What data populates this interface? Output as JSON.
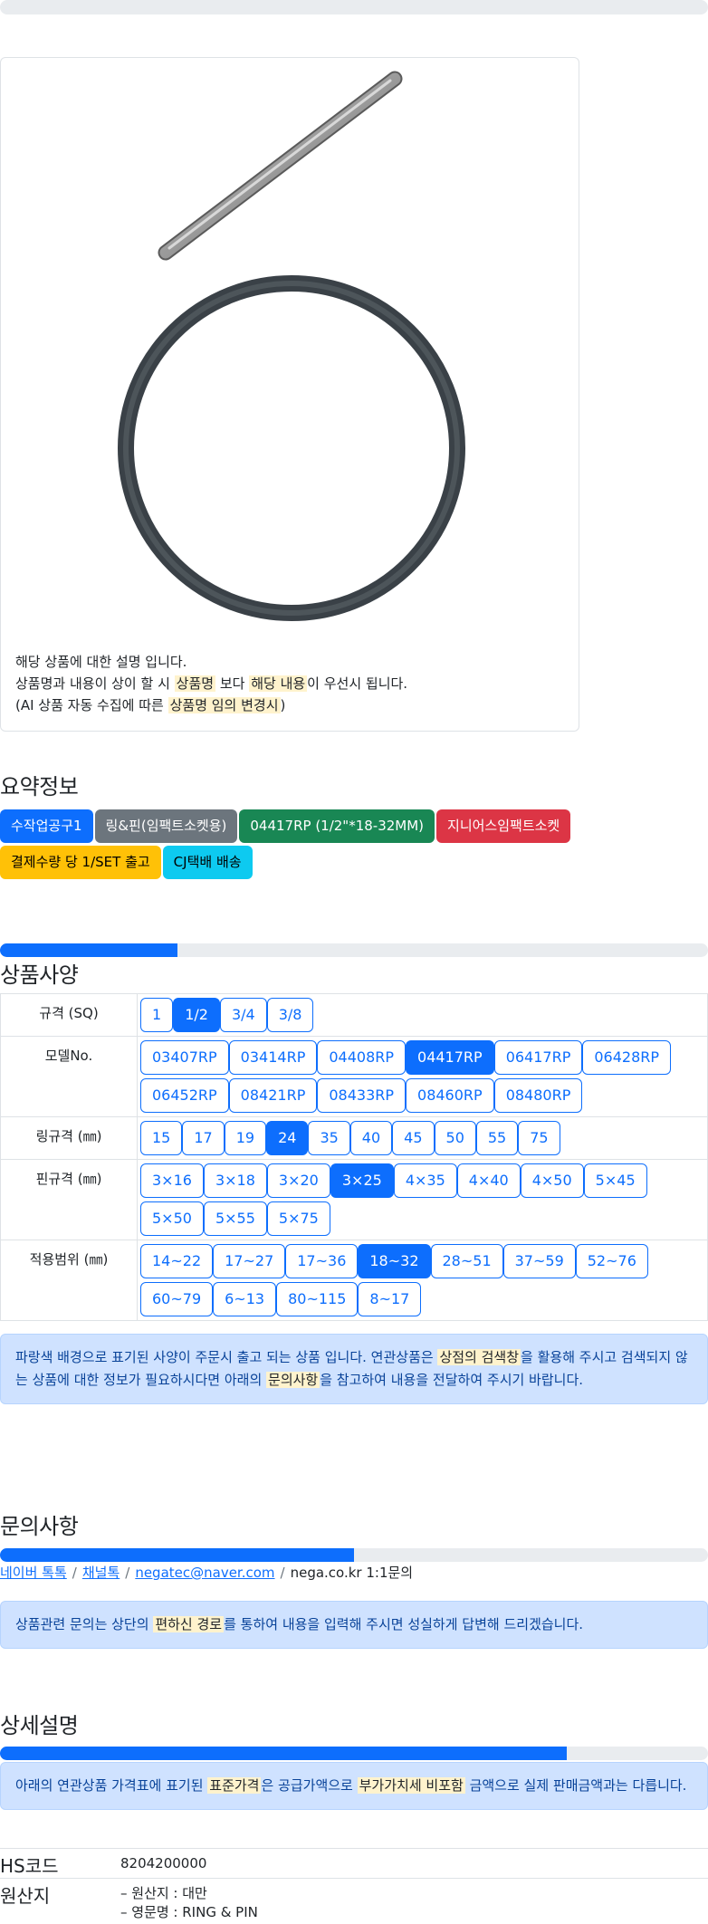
{
  "product_notice": {
    "line1": "해당 상품에 대한 설명 입니다.",
    "line2_a": "상품명과 내용이 상이 할 시 ",
    "line2_hl1": "상품명",
    "line2_b": " 보다 ",
    "line2_hl2": "해당 내용",
    "line2_c": "이 우선시 됩니다.",
    "line3_a": "(AI 상품 자동 수집에 따른 ",
    "line3_hl": "상품명 임의 변경시",
    "line3_b": ")"
  },
  "summary": {
    "title": "요약정보",
    "badges": [
      {
        "label": "수작업공구1",
        "color": "#0d6efd"
      },
      {
        "label": "링&핀(임팩트소켓용)",
        "color": "#6c757d"
      },
      {
        "label": "04417RP (1/2\"*18-32MM)",
        "color": "#198754"
      },
      {
        "label": "지니어스임팩트소켓",
        "color": "#dc3545"
      },
      {
        "label": "결제수량 당 1/SET 출고",
        "color": "#ffc107"
      },
      {
        "label": "CJ택배 배송",
        "color": "#0dcaf0"
      }
    ]
  },
  "spec": {
    "title": "상품사양",
    "progress": 0.25,
    "rows": [
      {
        "label": "규격 (SQ)",
        "options": [
          "1",
          "1/2",
          "3/4",
          "3/8"
        ],
        "selected": "1/2"
      },
      {
        "label": "모델No.",
        "options": [
          "03407RP",
          "03414RP",
          "04408RP",
          "04417RP",
          "06417RP",
          "06428RP",
          "06452RP",
          "08421RP",
          "08433RP",
          "08460RP",
          "08480RP"
        ],
        "selected": "04417RP"
      },
      {
        "label": "링규격 (㎜)",
        "options": [
          "15",
          "17",
          "19",
          "24",
          "35",
          "40",
          "45",
          "50",
          "55",
          "75"
        ],
        "selected": "24"
      },
      {
        "label": "핀규격 (㎜)",
        "options": [
          "3×16",
          "3×18",
          "3×20",
          "3×25",
          "4×35",
          "4×40",
          "4×50",
          "5×45",
          "5×50",
          "5×55",
          "5×75"
        ],
        "selected": "3×25"
      },
      {
        "label": "적용범위 (㎜)",
        "options": [
          "14~22",
          "17~27",
          "17~36",
          "18~32",
          "28~51",
          "37~59",
          "52~76",
          "60~79",
          "6~13",
          "80~115",
          "8~17"
        ],
        "selected": "18~32"
      }
    ],
    "notice_a": "파랑색 배경으로 표기된 사양이 주문시 출고 되는 상품 입니다. 연관상품은 ",
    "notice_hl1": "상점의 검색창",
    "notice_b": "을 활용해 주시고 검색되지 않는 상품에 대한 정보가 필요하시다면 아래의 ",
    "notice_hl2": "문의사항",
    "notice_c": "을 참고하여 내용을 전달하여 주시기 바랍니다."
  },
  "inquiry": {
    "title": "문의사항",
    "progress": 0.5,
    "links": [
      "네이버 톡톡",
      "채널톡",
      "negatec@naver.com"
    ],
    "last": "nega.co.kr 1:1문의",
    "notice_a": "상품관련 문의는 상단의 ",
    "notice_hl": "편하신 경로",
    "notice_b": "를 통하여 내용을 입력해 주시면 성실하게 답변해 드리겠습니다."
  },
  "detail": {
    "title": "상세설명",
    "progress": 0.8,
    "notice_a": "아래의 연관상품 가격표에 표기된 ",
    "notice_hl1": "표준가격",
    "notice_b": "은 공급가액으로 ",
    "notice_hl2": "부가가치세 비포함",
    "notice_c": " 금액으로 실제 판매금액과는 다릅니다.",
    "info": [
      {
        "key": "HS코드",
        "value": [
          "8204200000"
        ]
      },
      {
        "key": "원산지",
        "value": [
          "– 원산지 : 대만",
          "– 영문명 : RING & PIN"
        ]
      }
    ]
  }
}
